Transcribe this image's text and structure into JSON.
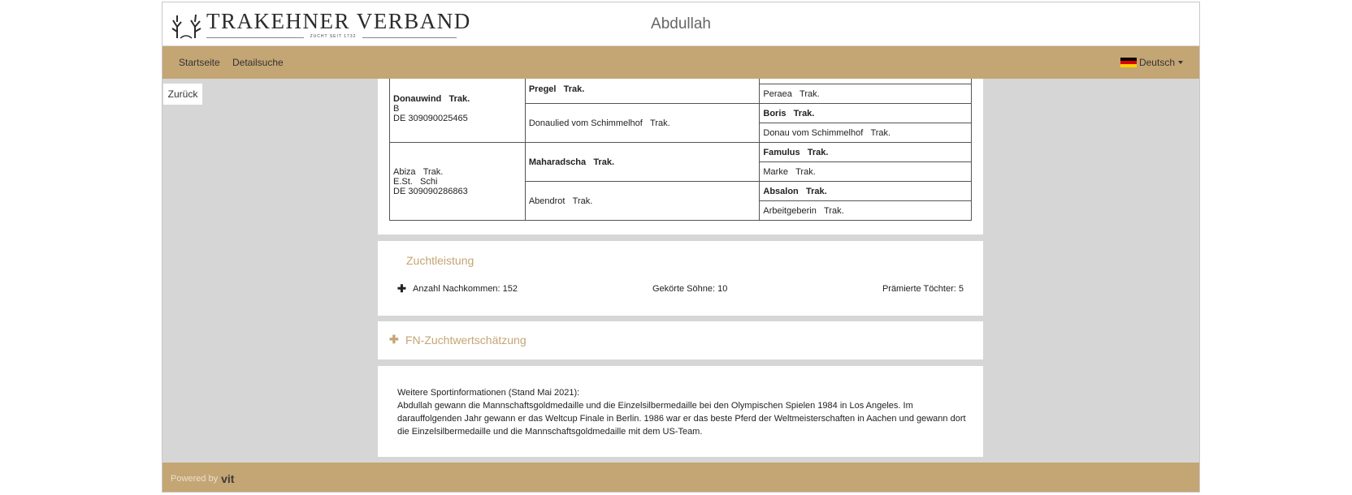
{
  "header": {
    "logo_text": "TRAKEHNER VERBAND",
    "logo_tagline": "ZUCHT SEIT 1732",
    "page_title": "Abdullah"
  },
  "nav": {
    "items": [
      {
        "label": "Startseite"
      },
      {
        "label": "Detailsuche"
      }
    ],
    "language": "Deutsch"
  },
  "back_button": "Zurück",
  "pedigree": {
    "parents": [
      {
        "name": "Donauwind",
        "breed": "Trak.",
        "line2": "B",
        "line3": "DE 309090025465"
      },
      {
        "name": "Abiza",
        "breed": "Trak.",
        "line2": "E.St.   Schi",
        "line3": "DE 309090286863"
      }
    ],
    "grandparents": [
      {
        "name": "Pregel",
        "breed": "Trak.",
        "bold": true
      },
      {
        "name": "Donaulied vom Schimmelhof",
        "breed": "Trak.",
        "bold": false
      },
      {
        "name": "Maharadscha",
        "breed": "Trak.",
        "bold": true
      },
      {
        "name": "Abendrot",
        "breed": "Trak.",
        "bold": false
      }
    ],
    "great_grandparents": [
      {
        "name": "Peraea",
        "breed": "Trak.",
        "bold": false
      },
      {
        "name": "Boris",
        "breed": "Trak.",
        "bold": true
      },
      {
        "name": "Donau vom Schimmelhof",
        "breed": "Trak.",
        "bold": false
      },
      {
        "name": "Famulus",
        "breed": "Trak.",
        "bold": true
      },
      {
        "name": "Marke",
        "breed": "Trak.",
        "bold": false
      },
      {
        "name": "Absalon",
        "breed": "Trak.",
        "bold": true
      },
      {
        "name": "Arbeitgeberin",
        "breed": "Trak.",
        "bold": false
      }
    ]
  },
  "zuchtleistung": {
    "title": "Zuchtleistung",
    "offspring": "Anzahl Nachkommen: 152",
    "sons": "Gekörte Söhne: 10",
    "daughters": "Prämierte Töchter: 5"
  },
  "fn": {
    "title": "FN-Zuchtwertschätzung"
  },
  "sport_info": {
    "heading": "Weitere Sportinformationen (Stand Mai 2021):",
    "body": "Abdullah gewann die Mannschaftsgoldmedaille und die Einzelsilbermedaille bei den Olympischen Spielen 1984 in Los Angeles. Im darauffolgenden Jahr gewann er das Weltcup Finale in Berlin. 1986 war er das beste Pferd der Weltmeisterschaften in Aachen und gewann dort die Einzelsilbermedaille und die Mannschaftsgoldmedaille mit dem US-Team."
  },
  "footer": {
    "powered_by": "Powered by",
    "brand": "vit"
  },
  "colors": {
    "accent": "#c4a574",
    "background": "#d6d6d6"
  }
}
